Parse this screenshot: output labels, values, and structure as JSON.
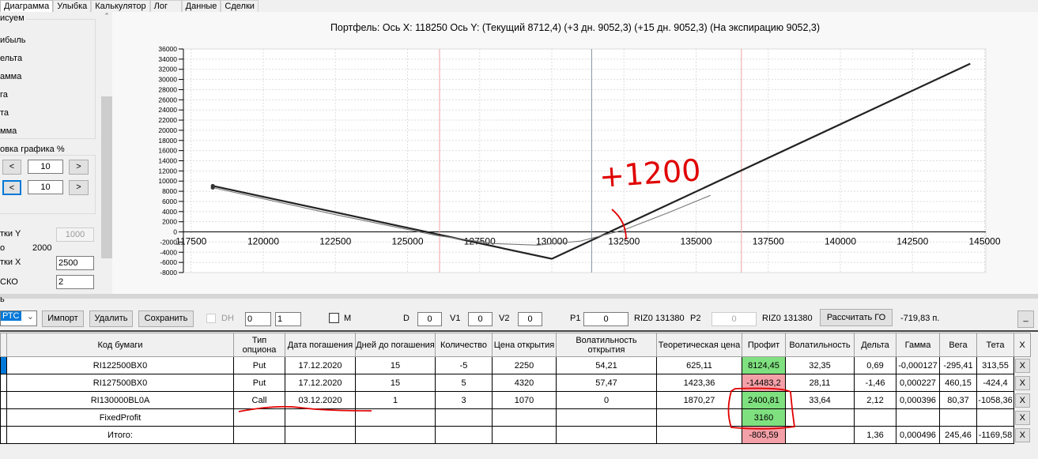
{
  "tabs": [
    "Диаграмма",
    "Улыбка",
    "Калькулятор",
    "Лог",
    "Данные",
    "Сделки"
  ],
  "left_panel": {
    "draw_group": "исуем",
    "draw_items": [
      "ибыль",
      "ельта",
      "амма",
      "га",
      "та",
      "мма"
    ],
    "shift_group": "овка графика %",
    "shift_rows": [
      {
        "prev": "<",
        "value": "10",
        "next": ">"
      },
      {
        "prev": "<",
        "value": "10",
        "next": ">"
      }
    ],
    "step_y_label": "тки Y",
    "step_y_value": "1000",
    "o_label": "о",
    "o_value": "2000",
    "step_x_label": "тки X",
    "step_x_value": "2500",
    "sko_label": "СКО",
    "sko_value": "2"
  },
  "chart_data": {
    "type": "line",
    "title": "Портфель: Ось X: 118250 Ось Y:  (Текущий 8712,4)  (+3 дн. 9052,3)  (+15 дн. 9052,3)  (На экспирацию 9052,3)",
    "xlim": [
      117000,
      145500
    ],
    "ylim": [
      -8000,
      36000
    ],
    "x_ticks": [
      117500,
      120000,
      122500,
      125000,
      127500,
      130000,
      132500,
      135000,
      137500,
      140000,
      142500,
      145000
    ],
    "y_ticks": [
      36000,
      34000,
      32000,
      30000,
      28000,
      26000,
      24000,
      22000,
      20000,
      18000,
      16000,
      14000,
      12000,
      10000,
      8000,
      6000,
      4000,
      2000,
      0,
      -2000,
      -4000,
      -6000,
      -8000
    ],
    "grid": true,
    "series": [
      {
        "style": "thick",
        "x": [
          118250,
          130000,
          144500
        ],
        "y": [
          9052,
          -5300,
          33100
        ]
      },
      {
        "style": "thin",
        "x": [
          118250,
          122500,
          126000,
          128000,
          129500,
          131000,
          132500,
          134000,
          135500
        ],
        "y": [
          8712,
          3400,
          -700,
          -2300,
          -2600,
          -1800,
          400,
          3700,
          7200
        ]
      }
    ],
    "vlines": [
      {
        "x": 126110,
        "color": "#f0a0a0"
      },
      {
        "x": 131380,
        "color": "#8090a0"
      },
      {
        "x": 136570,
        "color": "#f0a0a0"
      }
    ],
    "annotation": "+1200"
  },
  "toolbar": {
    "splitter_label": "ь",
    "combo": "РТС",
    "import": "Импорт",
    "delete": "Удалить",
    "save": "Сохранить",
    "dh": "DH",
    "spin1": "0",
    "spin2": "1",
    "m": "M",
    "d_label": "D",
    "d": "0",
    "v1_label": "V1",
    "v1": "0",
    "v2_label": "V2",
    "v2": "0",
    "p1_label": "P1",
    "p1": "0",
    "riz1": "RIZ0 131380",
    "p2_label": "P2",
    "p2": "0",
    "riz2": "RIZ0 131380",
    "calc": "Рассчитать ГО",
    "go_value": "-719,83 п.",
    "minimize": "_"
  },
  "table": {
    "headers": [
      "Код бумаги",
      "Тип опциона",
      "Дата погашения",
      "Дней до погашения",
      "Количество",
      "Цена открытия",
      "Волатильность открытия",
      "Теоретическая цена",
      "Профит",
      "Волатильность",
      "Дельта",
      "Гамма",
      "Вега",
      "Тета",
      "X"
    ],
    "rows": [
      [
        "RI122500BX0",
        "Put",
        "17.12.2020",
        "15",
        "-5",
        "2250",
        "54,21",
        "625,11",
        "8124,45",
        "32,35",
        "0,69",
        "-0,000127",
        "-295,41",
        "313,55",
        "X"
      ],
      [
        "RI127500BX0",
        "Put",
        "17.12.2020",
        "15",
        "5",
        "4320",
        "57,47",
        "1423,36",
        "-14483,2",
        "28,11",
        "-1,46",
        "0,000227",
        "460,15",
        "-424,4",
        "X"
      ],
      [
        "RI130000BL0A",
        "Call",
        "03.12.2020",
        "1",
        "3",
        "1070",
        "0",
        "1870,27",
        "2400,81",
        "33,64",
        "2,12",
        "0,000396",
        "80,37",
        "-1058,36",
        "X"
      ],
      [
        "FixedProfit",
        "",
        "",
        "",
        "",
        "",
        "",
        "",
        "3160",
        "",
        "",
        "",
        "",
        "",
        "X"
      ],
      [
        "Итого:",
        "",
        "",
        "",
        "",
        "",
        "",
        "",
        "-805,59",
        "",
        "1,36",
        "0,000496",
        "245,46",
        "-1169,58",
        "X"
      ]
    ],
    "profit_colors": [
      "green",
      "red",
      "green",
      "green",
      "red"
    ]
  }
}
